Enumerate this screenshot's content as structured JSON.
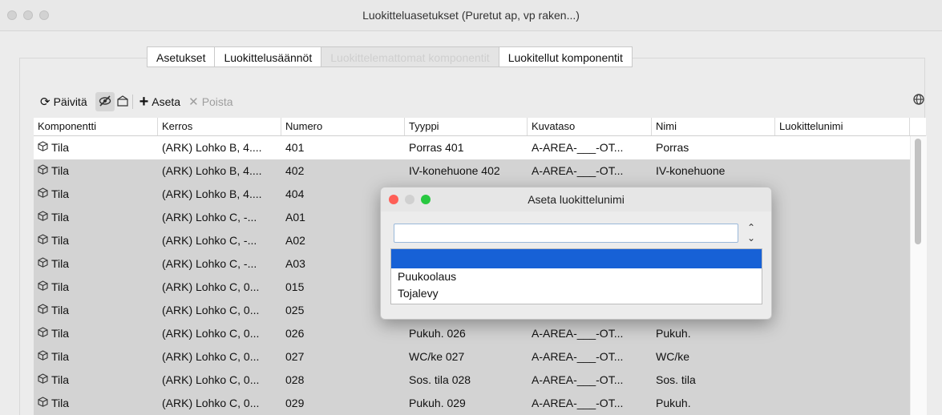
{
  "window": {
    "title": "Luokitteluasetukset (Puretut ap, vp raken...)",
    "traffic_colors": [
      "#d2d2d2",
      "#d2d2d2",
      "#d2d2d2"
    ]
  },
  "tabs": [
    {
      "label": "Asetukset",
      "enabled": true
    },
    {
      "label": "Luokittelusäännöt",
      "enabled": true
    },
    {
      "label": "Luokittelemattomat komponentit",
      "enabled": false,
      "active": true
    },
    {
      "label": "Luokitellut komponentit",
      "enabled": true
    }
  ],
  "toolbar": {
    "refresh_label": "Päivitä",
    "add_label": "Aseta",
    "remove_label": "Poista",
    "remove_enabled": false
  },
  "table": {
    "columns": [
      "Komponentti",
      "Kerros",
      "Numero",
      "Tyyppi",
      "Kuvataso",
      "Nimi",
      "Luokittelunimi"
    ],
    "rows": [
      {
        "selected": false,
        "cells": [
          "Tila",
          "(ARK) Lohko B, 4....",
          "401",
          "Porras 401",
          "A-AREA-___-OT...",
          "Porras",
          ""
        ]
      },
      {
        "selected": true,
        "cells": [
          "Tila",
          "(ARK) Lohko B, 4....",
          "402",
          "IV-konehuone 402",
          "A-AREA-___-OT...",
          "IV-konehuone",
          ""
        ]
      },
      {
        "selected": true,
        "cells": [
          "Tila",
          "(ARK) Lohko B, 4....",
          "404",
          "",
          "",
          "",
          ""
        ]
      },
      {
        "selected": true,
        "cells": [
          "Tila",
          "(ARK) Lohko C, -...",
          "A01",
          "",
          "",
          "",
          ""
        ]
      },
      {
        "selected": true,
        "cells": [
          "Tila",
          "(ARK) Lohko C, -...",
          "A02",
          "",
          "",
          "",
          ""
        ]
      },
      {
        "selected": true,
        "cells": [
          "Tila",
          "(ARK) Lohko C, -...",
          "A03",
          "",
          "",
          "",
          ""
        ]
      },
      {
        "selected": true,
        "cells": [
          "Tila",
          "(ARK) Lohko C, 0...",
          "015",
          "",
          "",
          "",
          ""
        ]
      },
      {
        "selected": true,
        "cells": [
          "Tila",
          "(ARK) Lohko C, 0...",
          "025",
          "",
          "",
          "",
          ""
        ]
      },
      {
        "selected": true,
        "cells": [
          "Tila",
          "(ARK) Lohko C, 0...",
          "026",
          "Pukuh. 026",
          "A-AREA-___-OT...",
          "Pukuh.",
          ""
        ]
      },
      {
        "selected": true,
        "cells": [
          "Tila",
          "(ARK) Lohko C, 0...",
          "027",
          "WC/ke 027",
          "A-AREA-___-OT...",
          "WC/ke",
          ""
        ]
      },
      {
        "selected": true,
        "cells": [
          "Tila",
          "(ARK) Lohko C, 0...",
          "028",
          "Sos. tila 028",
          "A-AREA-___-OT...",
          "Sos. tila",
          ""
        ]
      },
      {
        "selected": true,
        "cells": [
          "Tila",
          "(ARK) Lohko C, 0...",
          "029",
          "Pukuh. 029",
          "A-AREA-___-OT...",
          "Pukuh.",
          ""
        ]
      }
    ]
  },
  "dialog": {
    "title": "Aseta luokittelunimi",
    "input_value": "",
    "options": [
      "",
      "Puukoolaus",
      "Tojalevy"
    ],
    "selected_index": 0,
    "dot_colors": [
      "#fe5f57",
      "#d0d0d0",
      "#28c840"
    ]
  },
  "colors": {
    "selection_blue": "#1761d6",
    "row_selected": "#d3d3d3"
  }
}
